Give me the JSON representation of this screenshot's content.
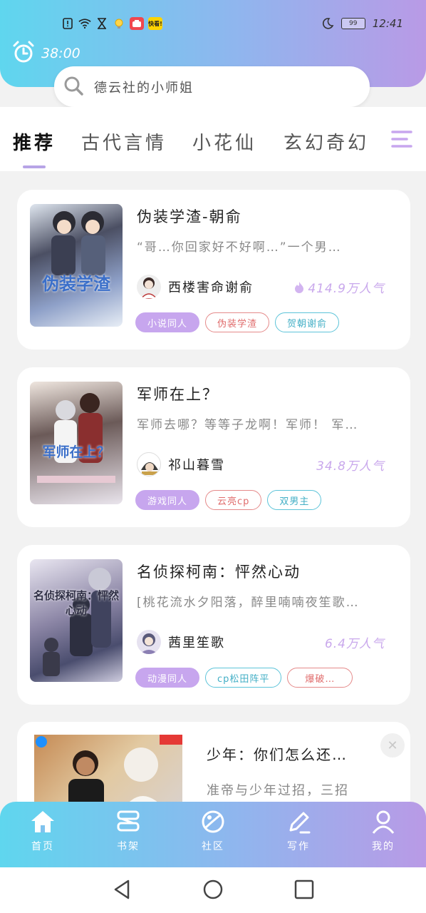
{
  "status_bar": {
    "time": "12:41",
    "battery": "99",
    "icons": [
      "alert-icon",
      "wifi-icon",
      "hourglass-icon",
      "bulb-icon",
      "app-red-icon",
      "app-yellow-icon",
      "moon-icon",
      "battery-icon"
    ],
    "app_yellow_label": "快看!"
  },
  "timer": {
    "text": "38:00"
  },
  "search": {
    "placeholder": "德云社的小师姐"
  },
  "tabs": [
    {
      "label": "推荐",
      "active": true
    },
    {
      "label": "古代言情"
    },
    {
      "label": "小花仙"
    },
    {
      "label": "玄幻奇幻"
    }
  ],
  "books": [
    {
      "title": "伪装学渣-朝俞",
      "description": "“哥…你回家好不好啊…”一个男…",
      "author": "西楼害命谢俞",
      "popularity": "414.9万人气",
      "cover_text": "伪装学渣",
      "tags": [
        {
          "label": "小说同人",
          "style": "fill"
        },
        {
          "label": "伪装学渣",
          "style": "red"
        },
        {
          "label": "贺朝谢俞",
          "style": "cyan"
        }
      ]
    },
    {
      "title": "军师在上？",
      "description": "军师去哪？等等子龙啊！军师！ 军…",
      "author": "祁山暮雪",
      "popularity": "34.8万人气",
      "cover_text": "军师在上？",
      "tags": [
        {
          "label": "游戏同人",
          "style": "fill"
        },
        {
          "label": "云亮cp",
          "style": "red"
        },
        {
          "label": "双男主",
          "style": "cyan"
        }
      ]
    },
    {
      "title": "名侦探柯南：怦然心动",
      "description": "[桃花流水夕阳落，醉里喃喃夜笙歌…",
      "author": "茜里笙歌",
      "popularity": "6.4万人气",
      "cover_text": "名侦探柯南：怦然心动",
      "tags": [
        {
          "label": "动漫同人",
          "style": "fill"
        },
        {
          "label": "cp松田阵平",
          "style": "cyan"
        },
        {
          "label": "爆破…",
          "style": "red"
        }
      ]
    }
  ],
  "ad": {
    "title": "少年：你们怎么还…",
    "description": "准帝与少年过招，三招"
  },
  "bottom_nav": [
    {
      "label": "首页",
      "icon": "home-icon"
    },
    {
      "label": "书架",
      "icon": "bookshelf-icon"
    },
    {
      "label": "社区",
      "icon": "planet-icon"
    },
    {
      "label": "写作",
      "icon": "pen-icon"
    },
    {
      "label": "我的",
      "icon": "user-icon"
    }
  ],
  "system_nav": [
    "back-icon",
    "home-circle-icon",
    "recents-icon"
  ]
}
